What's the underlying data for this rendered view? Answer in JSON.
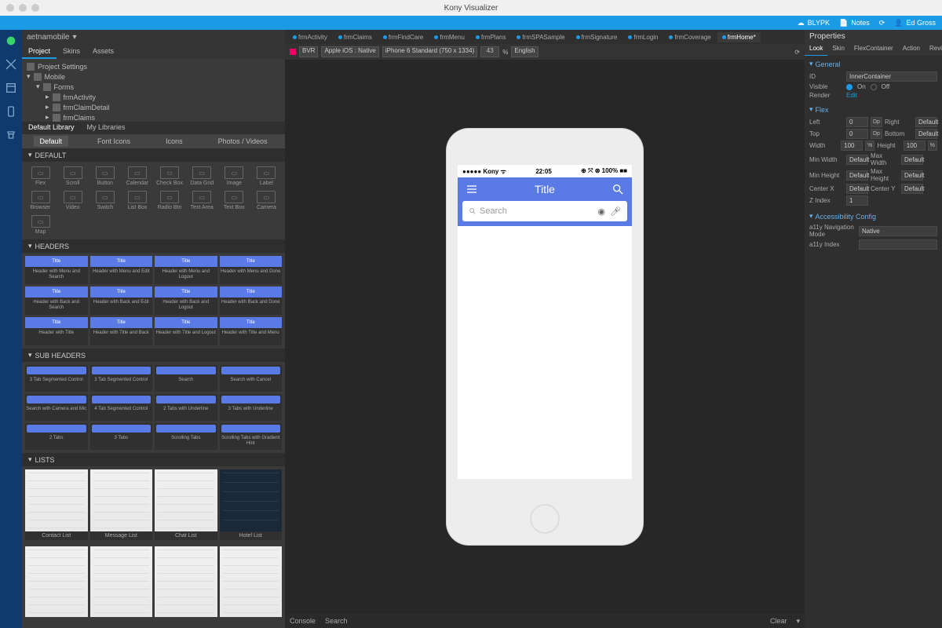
{
  "app": {
    "title": "Kony Visualizer"
  },
  "topbar": {
    "user1_cloud": "BLYPK",
    "notes": "Notes",
    "user2": "Ed Gross"
  },
  "breadcrumb": "aetnamobile",
  "projectTabs": [
    "Project",
    "Skins",
    "Assets"
  ],
  "tree": [
    {
      "label": "Project Settings",
      "indent": 0
    },
    {
      "label": "Mobile",
      "indent": 0
    },
    {
      "label": "Forms",
      "indent": 1
    },
    {
      "label": "frmActivity",
      "indent": 2
    },
    {
      "label": "frmClaimDetail",
      "indent": 2
    },
    {
      "label": "frmClaims",
      "indent": 2
    }
  ],
  "libraryTabs": [
    "Default Library",
    "My Libraries"
  ],
  "widgetCats": [
    "Default",
    "Font Icons",
    "Icons",
    "Photos / Videos"
  ],
  "defaultSection": "DEFAULT",
  "widgetsRow1": [
    "Flex",
    "Scroll",
    "Button",
    "Calendar",
    "Check Box",
    "Data Grid",
    "Image",
    "Label",
    "Browser",
    "Video",
    "Switch"
  ],
  "widgetsRow2": [
    "List Box",
    "Radio Btn",
    "Text Area",
    "Text Box",
    "Camera",
    "Map"
  ],
  "headersSection": "HEADERS",
  "headerItems": [
    "Header with Menu and Search",
    "Header with Menu and Edit",
    "Header with Menu and Logout",
    "Header with Menu and Done",
    "Header with Back and Search",
    "Header with Back and Edit",
    "Header with Back and Logout",
    "Header with Back and Done",
    "Header with Title",
    "Header with Title and Back",
    "Header with Title and Logout",
    "Header with Title and Menu"
  ],
  "headerMini": "Title",
  "subHeadersSection": "SUB HEADERS",
  "subHeaderItems": [
    "3 Tab Segmented Control",
    "3 Tab Segmented Control",
    "Search",
    "Search with Cancel",
    "Search with Camera and Mic",
    "4 Tab Segmented Control",
    "2 Tabs with Underline",
    "3 Tabs with Underline",
    "2 Tabs",
    "3 Tabs",
    "Scrolling Tabs",
    "Scrolling Tabs with Gradient Hint"
  ],
  "listsSection": "LISTS",
  "listItems1": [
    "Contact List",
    "Message List",
    "Chat List",
    "Hotel List"
  ],
  "listItems2": [
    "",
    "",
    "",
    ""
  ],
  "formTabs": [
    "frmActivity",
    "frmClaims",
    "frmFindCare",
    "frmMenu",
    "frmPlans",
    "frmSPASample",
    "frmSignature",
    "frmLogin",
    "frmCoverage",
    "frmHome*"
  ],
  "activeFormTabIndex": 9,
  "canvasToolbar": {
    "channel": "BVR",
    "platform": "Apple iOS : Native",
    "device": "iPhone 6 Standard (750 x 1334)",
    "zoom": "43",
    "pct": "%",
    "lang": "English"
  },
  "phone": {
    "carrier": "●●●●● Kony ᯤ",
    "time": "22:05",
    "battery": "⊕ ⤧ ⊛ 100% ■■",
    "title": "Title",
    "searchPlaceholder": "Search"
  },
  "consoleTabs": [
    "Console",
    "Search"
  ],
  "consoleClear": "Clear",
  "propsTitle": "Properties",
  "propTabs": [
    "Look",
    "Skin",
    "FlexContainer",
    "Action",
    "Review"
  ],
  "generalSection": "General",
  "general": {
    "idLabel": "ID",
    "id": "InnerContainer",
    "visibleLabel": "Visible",
    "visOn": "On",
    "visOff": "Off",
    "renderLabel": "Render",
    "renderVal": "Edit"
  },
  "flexSection": "Flex",
  "flex": {
    "leftLabel": "Left",
    "left": "0",
    "leftUnit": "Dp",
    "rightLabel": "Right",
    "right": "Default",
    "topLabel": "Top",
    "top": "0",
    "topUnit": "Dp",
    "bottomLabel": "Bottom",
    "bottom": "Default",
    "widthLabel": "Width",
    "width": "100",
    "widthUnit": "%",
    "heightLabel": "Height",
    "height": "100",
    "heightUnit": "%",
    "minWidthLabel": "Min Width",
    "minWidth": "Default",
    "maxWidthLabel": "Max Width",
    "maxWidth": "Default",
    "minHeightLabel": "Min Height",
    "minHeight": "Default",
    "maxHeightLabel": "Max Height",
    "maxHeight": "Default",
    "centerXLabel": "Center X",
    "centerX": "Default",
    "centerYLabel": "Center Y",
    "centerY": "Default",
    "zIndexLabel": "Z Index",
    "zIndex": "1"
  },
  "a11ySection": "Accessibility Config",
  "a11y": {
    "navModeLabel": "a11y Navigation Mode",
    "navMode": "Native",
    "indexLabel": "a11y Index"
  }
}
